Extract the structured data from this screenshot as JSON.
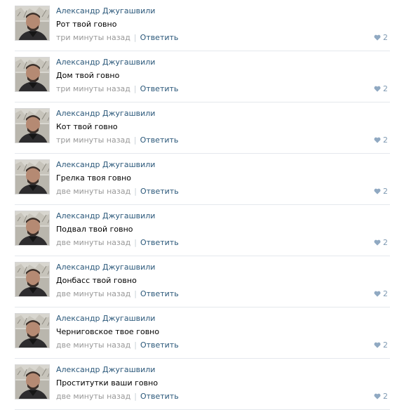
{
  "comments": [
    {
      "author": "Александр Джугашвили",
      "text": "Рот твой говно",
      "time": "три минуты назад",
      "reply": "Ответить",
      "likes": "2"
    },
    {
      "author": "Александр Джугашвили",
      "text": "Дом твой говно",
      "time": "три минуты назад",
      "reply": "Ответить",
      "likes": "2"
    },
    {
      "author": "Александр Джугашвили",
      "text": "Кот твой говно",
      "time": "три минуты назад",
      "reply": "Ответить",
      "likes": "2"
    },
    {
      "author": "Александр Джугашвили",
      "text": "Грелка твоя говно",
      "time": "две минуты назад",
      "reply": "Ответить",
      "likes": "2"
    },
    {
      "author": "Александр Джугашвили",
      "text": "Подвал твой говно",
      "time": "две минуты назад",
      "reply": "Ответить",
      "likes": "2"
    },
    {
      "author": "Александр Джугашвили",
      "text": "Донбасс твой говно",
      "time": "две минуты назад",
      "reply": "Ответить",
      "likes": "2"
    },
    {
      "author": "Александр Джугашвили",
      "text": "Черниговское твое говно",
      "time": "две минуты назад",
      "reply": "Ответить",
      "likes": "2"
    },
    {
      "author": "Александр Джугашвили",
      "text": "Проститутки ваши говно",
      "time": "две минуты назад",
      "reply": "Ответить",
      "likes": "2"
    }
  ],
  "separator": "|",
  "icons": {
    "like": "heart-icon",
    "avatar": "user-photo"
  },
  "colors": {
    "author_link": "#2b587a",
    "timestamp": "#999999",
    "heart": "#90a9c2",
    "like_count": "#7f9ab3"
  }
}
